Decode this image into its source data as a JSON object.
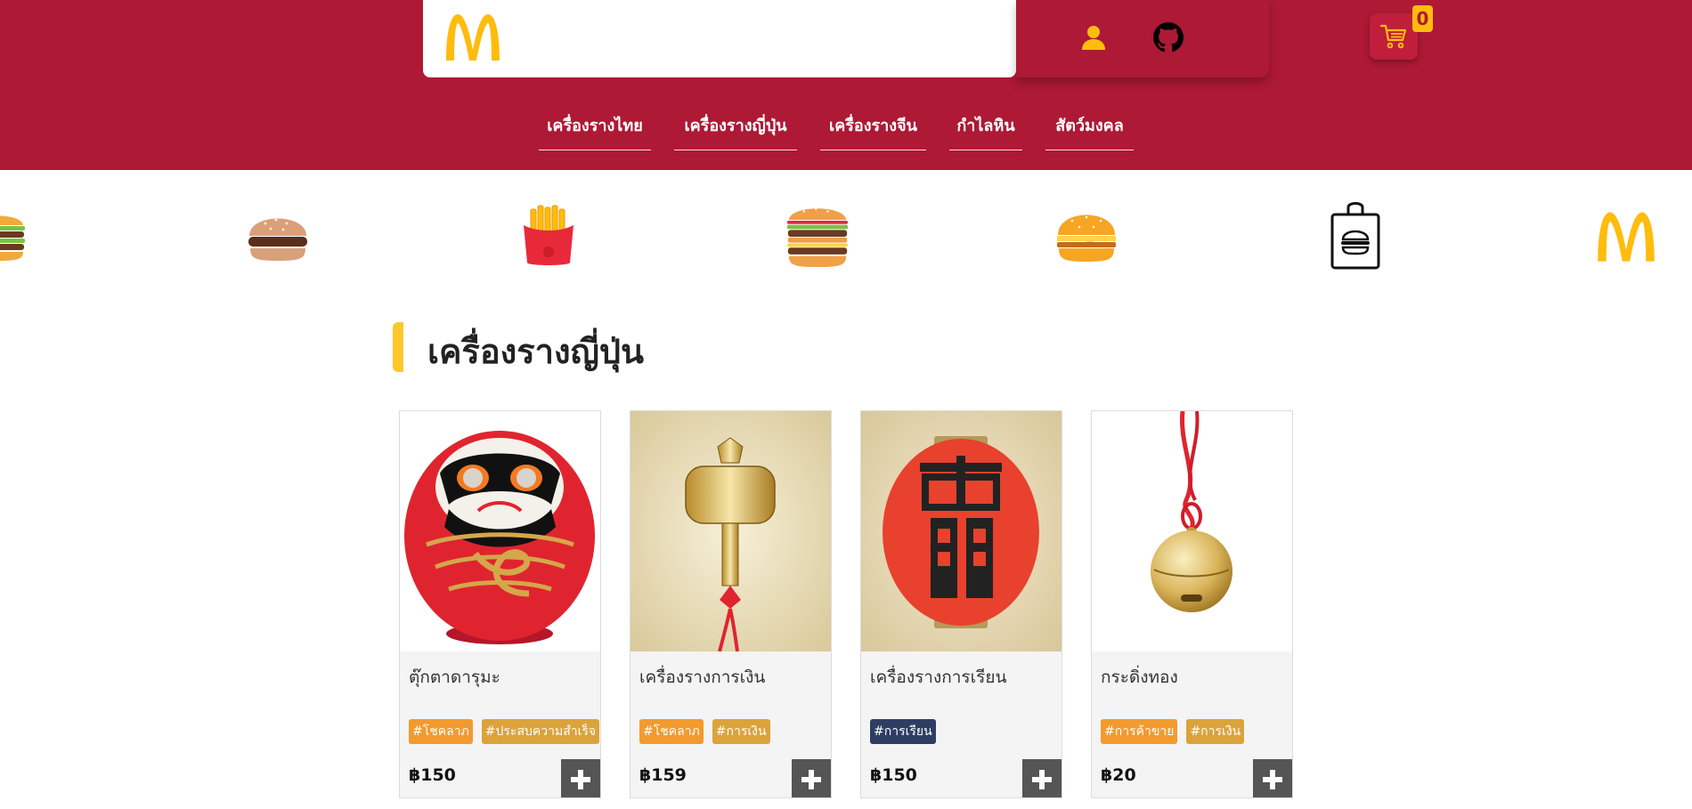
{
  "header": {
    "logo_icon": "mcdonalds-arches-logo",
    "user_icon": "user-icon",
    "github_icon": "github-icon",
    "cart_icon": "cart-icon",
    "cart_count": "0",
    "colors": {
      "brand_red": "#ae1935",
      "brand_yellow": "#ffbc0d"
    }
  },
  "nav": {
    "items": [
      {
        "label": "เครื่องรางไทย"
      },
      {
        "label": "เครื่องรางญี่ปุ่น"
      },
      {
        "label": "เครื่องรางจีน"
      },
      {
        "label": "กำไลหิน"
      },
      {
        "label": "สัตว์มงคล"
      }
    ]
  },
  "food_strip": {
    "icons": [
      "big-burger-icon",
      "burger-icon",
      "fries-icon",
      "big-mac-icon",
      "cheeseburger-icon",
      "shopping-bag-icon",
      "mcdonalds-arches-logo"
    ]
  },
  "section": {
    "title": "เครื่องรางญี่ปุ่น"
  },
  "products": [
    {
      "name": "ตุ๊กตาดารุมะ",
      "image": "daruma-doll",
      "tags": [
        {
          "label": "#โชคลาภ",
          "color": "#f39a2e"
        },
        {
          "label": "#ประสบความสำเร็จ",
          "color": "#dba33a"
        }
      ],
      "price": "฿150"
    },
    {
      "name": "เครื่องรางการเงิน",
      "image": "gold-mallet-charm",
      "tags": [
        {
          "label": "#โชคลาภ",
          "color": "#f39a2e"
        },
        {
          "label": "#การเงิน",
          "color": "#dba33a"
        }
      ],
      "price": "฿159"
    },
    {
      "name": "เครื่องรางการเรียน",
      "image": "red-lantern-charm",
      "tags": [
        {
          "label": "#การเรียน",
          "color": "#2e3d63"
        }
      ],
      "price": "฿150"
    },
    {
      "name": "กระดิ่งทอง",
      "image": "gold-bell-charm",
      "tags": [
        {
          "label": "#การค้าขาย",
          "color": "#f39a2e"
        },
        {
          "label": "#การเงิน",
          "color": "#dba33a"
        }
      ],
      "price": "฿20"
    }
  ]
}
